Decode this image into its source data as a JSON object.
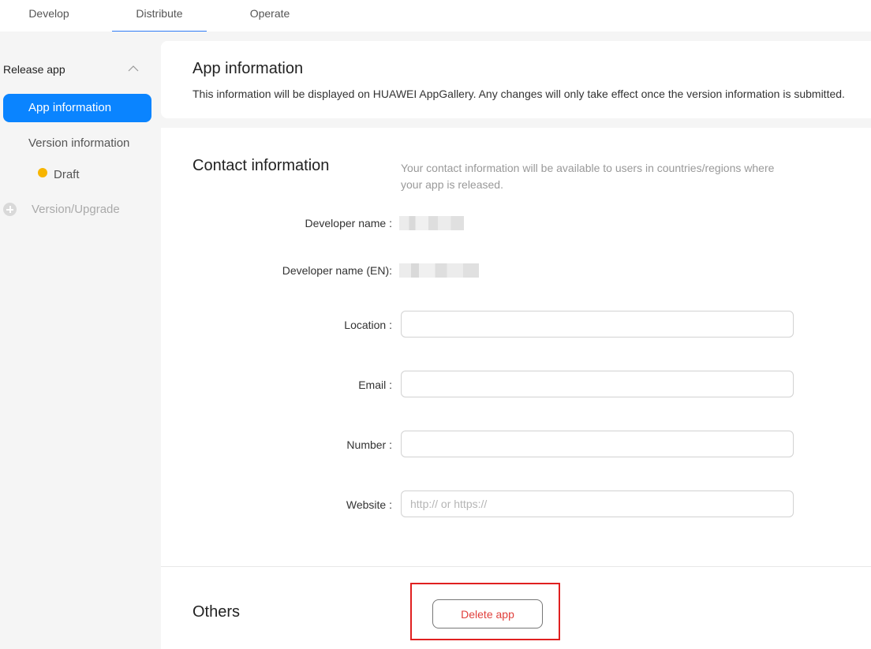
{
  "topnav": {
    "tabs": [
      {
        "label": "Develop"
      },
      {
        "label": "Distribute",
        "active": true
      },
      {
        "label": "Operate"
      }
    ],
    "accent_color": "#2f7cf6"
  },
  "sidebar": {
    "section_title": "Release app",
    "items": {
      "app_information": "App information",
      "version_information": "Version information",
      "draft": "Draft",
      "version_upgrade": "Version/Upgrade"
    },
    "active_color": "#0a84ff",
    "draft_dot_color": "#f7b500"
  },
  "header": {
    "title": "App information",
    "description": "This information will be displayed on HUAWEI AppGallery. Any changes will only take effect once the version information is submitted."
  },
  "contact": {
    "title": "Contact information",
    "description": "Your contact information will be available to users in countries/regions where your app is released.",
    "fields": {
      "developer_name": {
        "label": "Developer name :",
        "value_redacted": true
      },
      "developer_name_en": {
        "label": "Developer name (EN):",
        "value_redacted": true
      },
      "location": {
        "label": "Location :",
        "value": "",
        "placeholder": ""
      },
      "email": {
        "label": "Email :",
        "value": "",
        "placeholder": ""
      },
      "number": {
        "label": "Number :",
        "value": "",
        "placeholder": ""
      },
      "website": {
        "label": "Website :",
        "value": "",
        "placeholder": "http:// or https://"
      }
    }
  },
  "others": {
    "title": "Others",
    "delete_label": "Delete app",
    "delete_color": "#e0403c",
    "highlight_color": "#e02020"
  }
}
